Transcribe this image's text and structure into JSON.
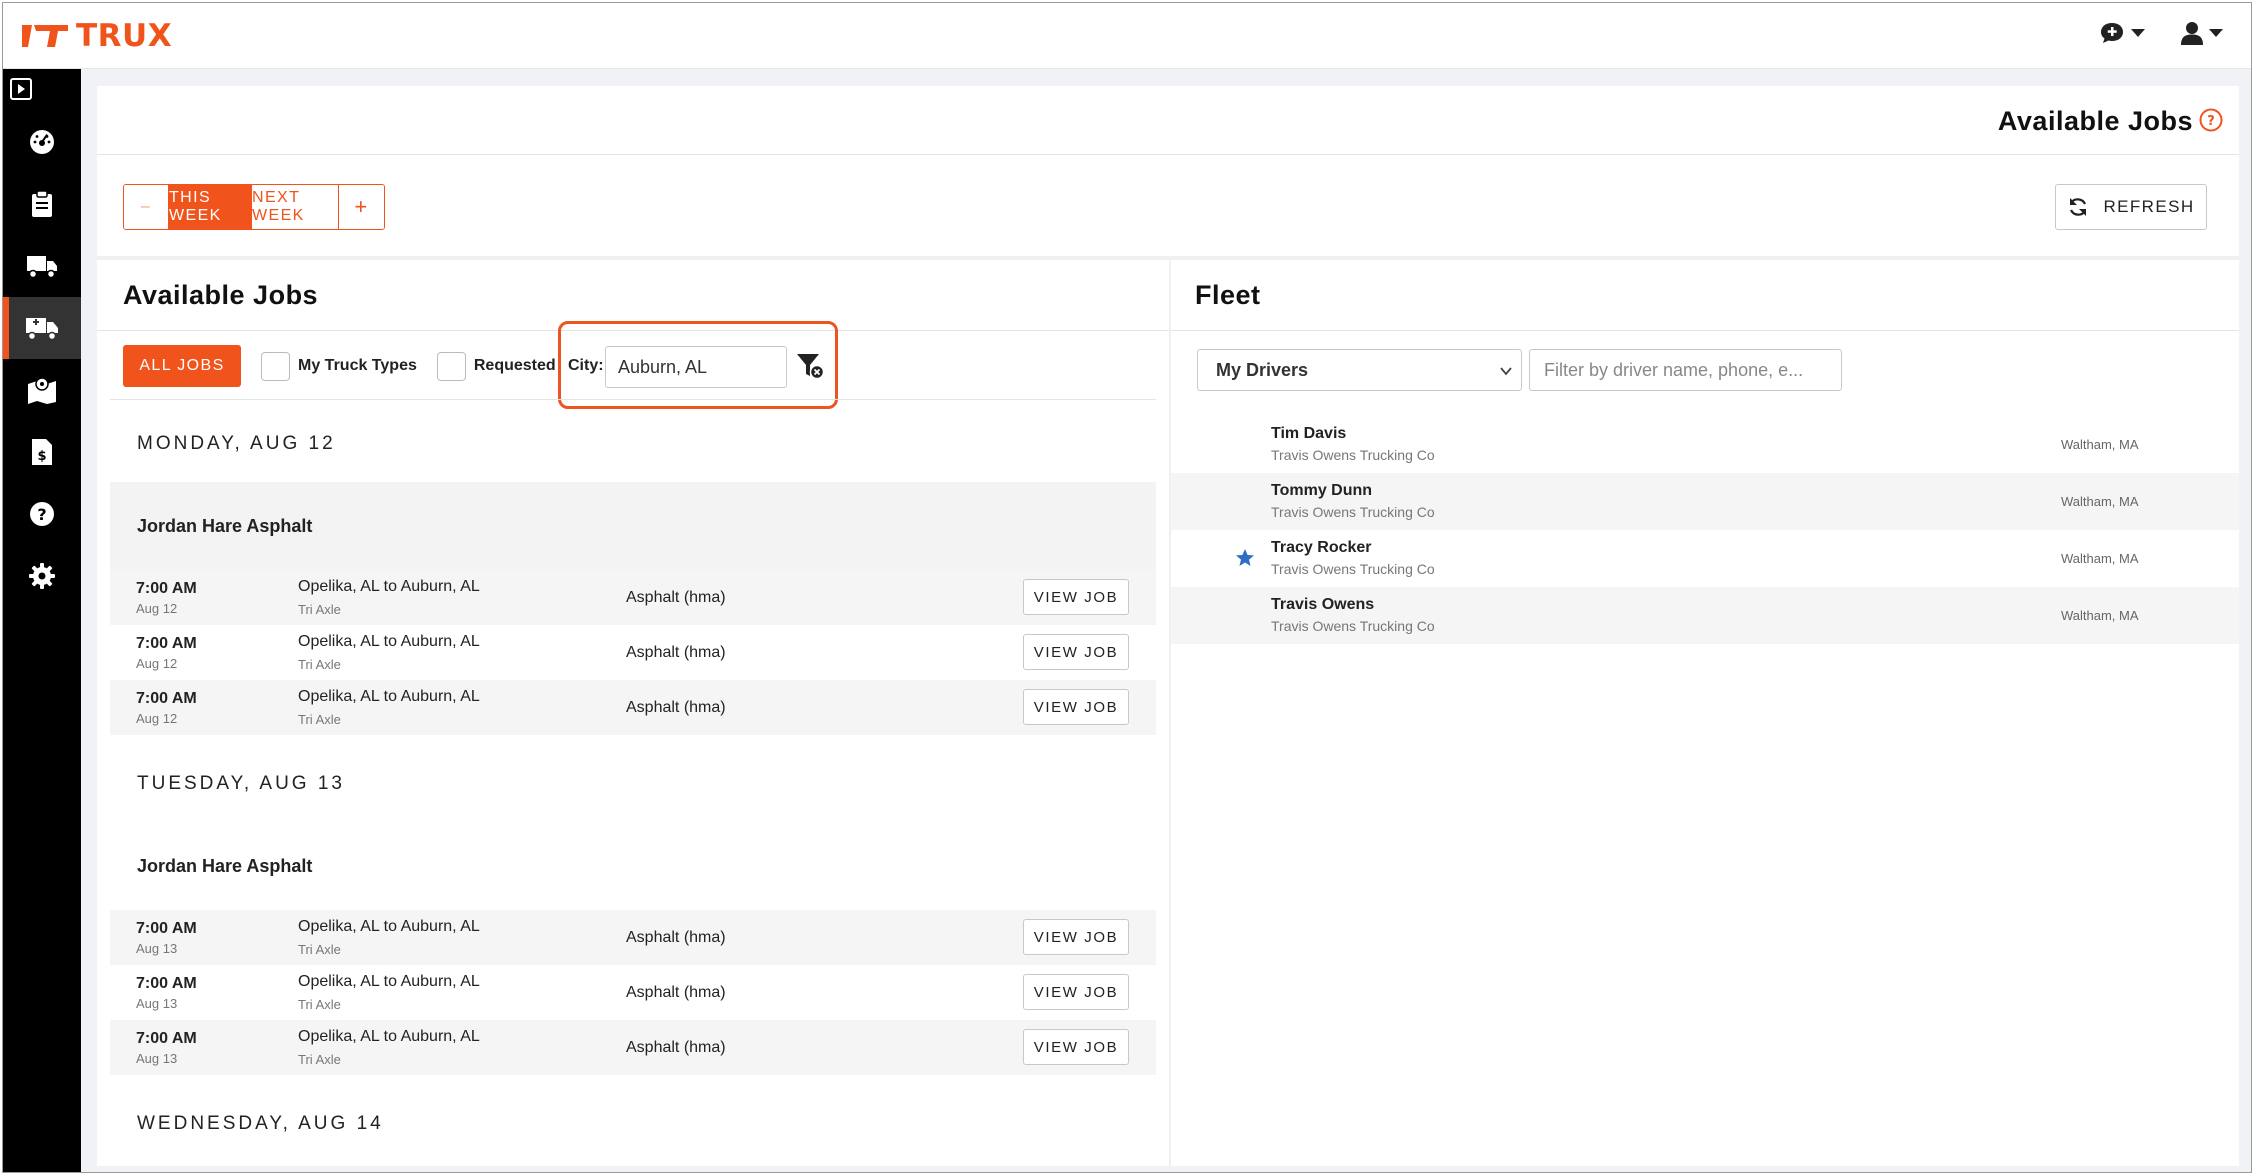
{
  "brand": {
    "name": "TRUX",
    "accent": "#f0531c"
  },
  "topbar": {
    "chat_icon": "chat-icon",
    "user_icon": "user-icon"
  },
  "sidebar": {
    "items": [
      {
        "icon": "dashboard-icon"
      },
      {
        "icon": "clipboard-icon"
      },
      {
        "icon": "truck-icon"
      },
      {
        "icon": "truck-jobs-icon",
        "active": true
      },
      {
        "icon": "map-icon"
      },
      {
        "icon": "invoice-icon"
      },
      {
        "icon": "help-icon"
      },
      {
        "icon": "gear-icon"
      }
    ]
  },
  "page": {
    "title": "Available Jobs"
  },
  "week_nav": {
    "prev": "–",
    "this_week": "THIS WEEK",
    "next_week": "NEXT WEEK",
    "next": "+"
  },
  "refresh_label": "REFRESH",
  "jobs_panel": {
    "title": "Available Jobs",
    "all_jobs": "ALL JOBS",
    "my_truck_types": "My Truck Types",
    "requested": "Requested",
    "city_label": "City:",
    "city_value": "Auburn, AL",
    "days": [
      {
        "label": "MONDAY, AUG 12",
        "company": "Jordan Hare Asphalt",
        "jobs": [
          {
            "time": "7:00 AM",
            "date": "Aug 12",
            "route": "Opelika, AL to Auburn, AL",
            "truck": "Tri Axle",
            "material": "Asphalt (hma)",
            "action": "VIEW JOB"
          },
          {
            "time": "7:00 AM",
            "date": "Aug 12",
            "route": "Opelika, AL to Auburn, AL",
            "truck": "Tri Axle",
            "material": "Asphalt (hma)",
            "action": "VIEW JOB"
          },
          {
            "time": "7:00 AM",
            "date": "Aug 12",
            "route": "Opelika, AL to Auburn, AL",
            "truck": "Tri Axle",
            "material": "Asphalt (hma)",
            "action": "VIEW JOB"
          }
        ]
      },
      {
        "label": "TUESDAY, AUG 13",
        "company": "Jordan Hare Asphalt",
        "jobs": [
          {
            "time": "7:00 AM",
            "date": "Aug 13",
            "route": "Opelika, AL to Auburn, AL",
            "truck": "Tri Axle",
            "material": "Asphalt (hma)",
            "action": "VIEW JOB"
          },
          {
            "time": "7:00 AM",
            "date": "Aug 13",
            "route": "Opelika, AL to Auburn, AL",
            "truck": "Tri Axle",
            "material": "Asphalt (hma)",
            "action": "VIEW JOB"
          },
          {
            "time": "7:00 AM",
            "date": "Aug 13",
            "route": "Opelika, AL to Auburn, AL",
            "truck": "Tri Axle",
            "material": "Asphalt (hma)",
            "action": "VIEW JOB"
          }
        ]
      },
      {
        "label": "WEDNESDAY, AUG 14"
      }
    ]
  },
  "fleet_panel": {
    "title": "Fleet",
    "select_value": "My Drivers",
    "filter_placeholder": "Filter by driver name, phone, e...",
    "drivers": [
      {
        "name": "Tim Davis",
        "company": "Travis Owens Trucking Co",
        "location": "Waltham, MA",
        "starred": false
      },
      {
        "name": "Tommy Dunn",
        "company": "Travis Owens Trucking Co",
        "location": "Waltham, MA",
        "starred": false
      },
      {
        "name": "Tracy Rocker",
        "company": "Travis Owens Trucking Co",
        "location": "Waltham, MA",
        "starred": true
      },
      {
        "name": "Travis Owens",
        "company": "Travis Owens Trucking Co",
        "location": "Waltham, MA",
        "starred": false
      }
    ]
  }
}
